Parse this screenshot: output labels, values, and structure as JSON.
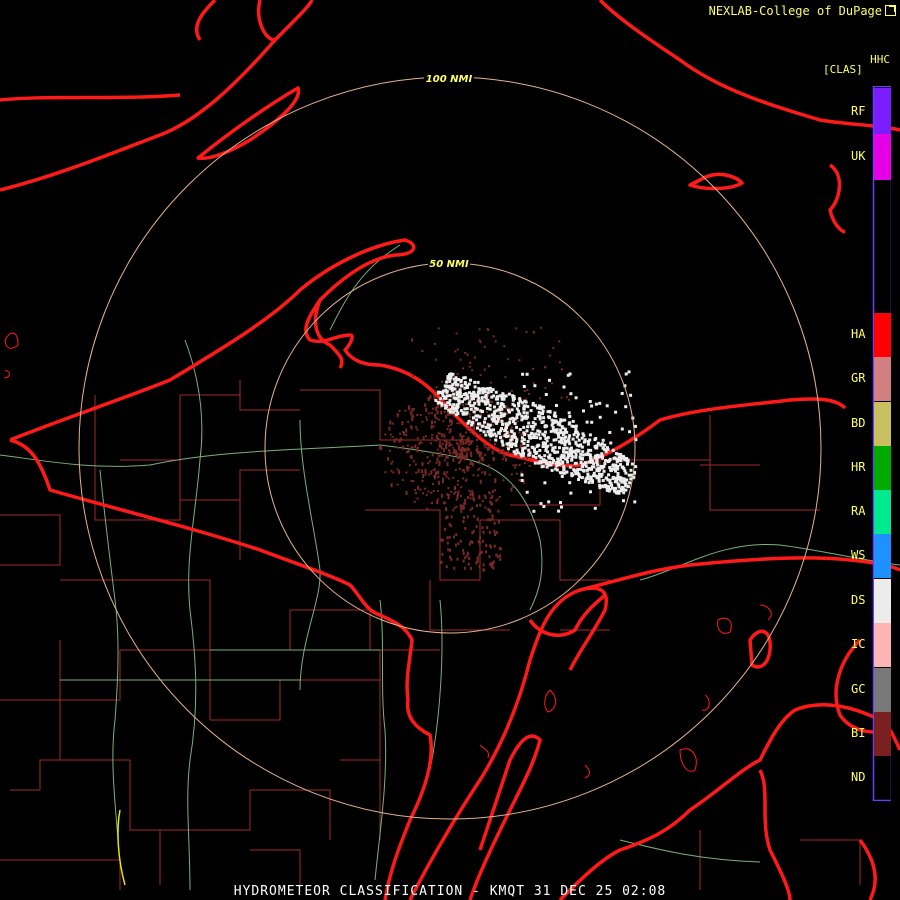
{
  "credit": "NEXLAB-College of DuPage",
  "product": {
    "code": "HHC",
    "sub": "[CLAS]"
  },
  "footer": "HYDROMETEOR CLASSIFICATION - KMQT 31 DEC 25 02:08",
  "rings": [
    {
      "label": "100 NMI"
    },
    {
      "label": "50 NMI"
    }
  ],
  "legend": [
    {
      "code": "RF",
      "color": "#7a1eff"
    },
    {
      "code": "UK",
      "color": "#e600e6"
    },
    {
      "code": "HA",
      "color": "#ff0000"
    },
    {
      "code": "GR",
      "color": "#d08080"
    },
    {
      "code": "BD",
      "color": "#c8c060"
    },
    {
      "code": "HR",
      "color": "#00aa00"
    },
    {
      "code": "RA",
      "color": "#00e890"
    },
    {
      "code": "WS",
      "color": "#1e90ff"
    },
    {
      "code": "DS",
      "color": "#ececec"
    },
    {
      "code": "IC",
      "color": "#ffb4b4"
    },
    {
      "code": "GC",
      "color": "#787878"
    },
    {
      "code": "BI",
      "color": "#7a2020"
    },
    {
      "code": "ND",
      "color": "#000000"
    }
  ],
  "colors": {
    "coastline": "#ff1a1a",
    "county": "#a52a2a",
    "highway": "#7ab07a",
    "ring": "#e6b48c",
    "label": "#ffff66"
  }
}
